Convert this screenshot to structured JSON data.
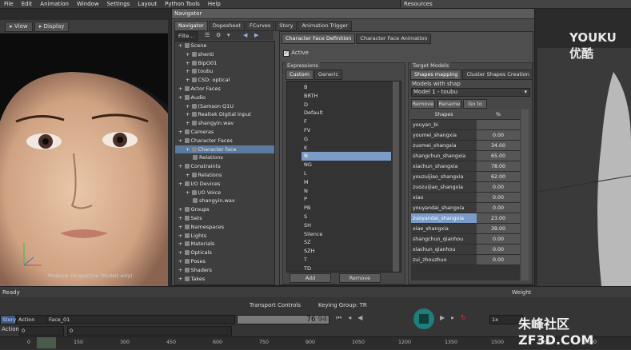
{
  "menubar": [
    "File",
    "Edit",
    "Animation",
    "Window",
    "Settings",
    "Layout",
    "Python Tools",
    "Help"
  ],
  "resources_title": "Resources",
  "viewer": {
    "view_label": "View",
    "display_label": "Display",
    "camera_label": "Producer Perspective (Models only)"
  },
  "watermark_tr": "YOUKU 优酷",
  "watermark_br": "朱峰社区 ZF3D.COM",
  "navigator": {
    "title": "Navigator",
    "tabs": [
      "Navigator",
      "Dopesheet",
      "FCurves",
      "Story",
      "Animation Trigger"
    ],
    "filter_label": "Filte...",
    "tree": [
      {
        "label": "Scene",
        "level": 0
      },
      {
        "label": "shenti",
        "level": 1
      },
      {
        "label": "BipO01",
        "level": 1
      },
      {
        "label": "toubu",
        "level": 1
      },
      {
        "label": "CSD: optical",
        "level": 1
      },
      {
        "label": "Actor Faces",
        "level": 0
      },
      {
        "label": "Audio",
        "level": 0
      },
      {
        "label": "(Samson Q1U",
        "level": 1
      },
      {
        "label": "Realtek Digital Input",
        "level": 1
      },
      {
        "label": "shangyin.wav",
        "level": 1
      },
      {
        "label": "Cameras",
        "level": 0
      },
      {
        "label": "Character Faces",
        "level": 0
      },
      {
        "label": "Character face",
        "level": 1,
        "selected": true
      },
      {
        "label": "Relations",
        "level": 2
      },
      {
        "label": "Constraints",
        "level": 0
      },
      {
        "label": "Relations",
        "level": 1
      },
      {
        "label": "I/O Devices",
        "level": 0
      },
      {
        "label": "I/O Voice",
        "level": 1
      },
      {
        "label": "shangyin.wav",
        "level": 2
      },
      {
        "label": "Groups",
        "level": 0
      },
      {
        "label": "Sets",
        "level": 0
      },
      {
        "label": "Namespaces",
        "level": 0
      },
      {
        "label": "Lights",
        "level": 0
      },
      {
        "label": "Materials",
        "level": 0
      },
      {
        "label": "Opticals",
        "level": 0
      },
      {
        "label": "Poses",
        "level": 0
      },
      {
        "label": "Shaders",
        "level": 0
      },
      {
        "label": "Takes",
        "level": 0
      },
      {
        "label": "Textures",
        "level": 0
      },
      {
        "label": "Videos",
        "level": 0
      },
      {
        "label": "System",
        "level": 0
      }
    ],
    "panel_tabs": [
      "Character Face Definition",
      "Character Face Animation"
    ],
    "active_label": "Active",
    "expressions": {
      "label": "Expressions",
      "tabs": [
        "Custom",
        "Generic"
      ],
      "items": [
        "B",
        "BRTH",
        "D",
        "Default",
        "F",
        "FV",
        "G",
        "K",
        "N",
        "NG",
        "L",
        "M",
        "N",
        "P",
        "PB",
        "S",
        "SH",
        "Silence",
        "SZ",
        "SZH",
        "T",
        "TD",
        "V"
      ],
      "selected_index": 8,
      "add_label": "Add",
      "remove_label": "Remove"
    },
    "target": {
      "label": "Target Models",
      "tabs": [
        "Shapes mapping",
        "Cluster Shapes Creation"
      ],
      "models_label": "Models with shap",
      "model_value": "Model 1 - toubu",
      "remove_label": "Remove",
      "rename_label": "Rename",
      "goto_label": "Go to",
      "col_shapes": "Shapes",
      "col_pct": "%",
      "rows": [
        {
          "name": "youyan_bi",
          "val": ""
        },
        {
          "name": "youmei_shangxia",
          "val": "0.00"
        },
        {
          "name": "zuomei_shangxia",
          "val": "34.00"
        },
        {
          "name": "shangchun_shangxia",
          "val": "65.00"
        },
        {
          "name": "xiachun_shangxia",
          "val": "78.00"
        },
        {
          "name": "youzuijiao_shangxia",
          "val": "62.00"
        },
        {
          "name": "zuozuijiao_shangxia",
          "val": "0.00"
        },
        {
          "name": "xiao",
          "val": "0.00"
        },
        {
          "name": "youyandai_shangxia",
          "val": "0.00"
        },
        {
          "name": "zuoyandai_shangxia",
          "val": "23.00",
          "selected": true
        },
        {
          "name": "xiae_shangxia",
          "val": "39.00"
        },
        {
          "name": "shangchun_qianhou",
          "val": "0.00"
        },
        {
          "name": "xiachun_qianhou",
          "val": "0.00"
        },
        {
          "name": "zui_zhouzhuo",
          "val": "0.00"
        }
      ]
    }
  },
  "status": {
    "ready": "Ready",
    "weight": "Weight"
  },
  "transport": {
    "title": "Transport Controls",
    "keying": "Keying Group: TR",
    "story": "Story",
    "action": "Action",
    "face": "Face_01",
    "frame_a": "76",
    "frame_b": "94",
    "speed": "1x",
    "action_short": "Action",
    "start": "0",
    "start2": "0",
    "ticks": [
      "0",
      "150",
      "300",
      "450",
      "600",
      "750",
      "900",
      "1050",
      "1200",
      "1350",
      "1500",
      "1650",
      "1800"
    ]
  }
}
